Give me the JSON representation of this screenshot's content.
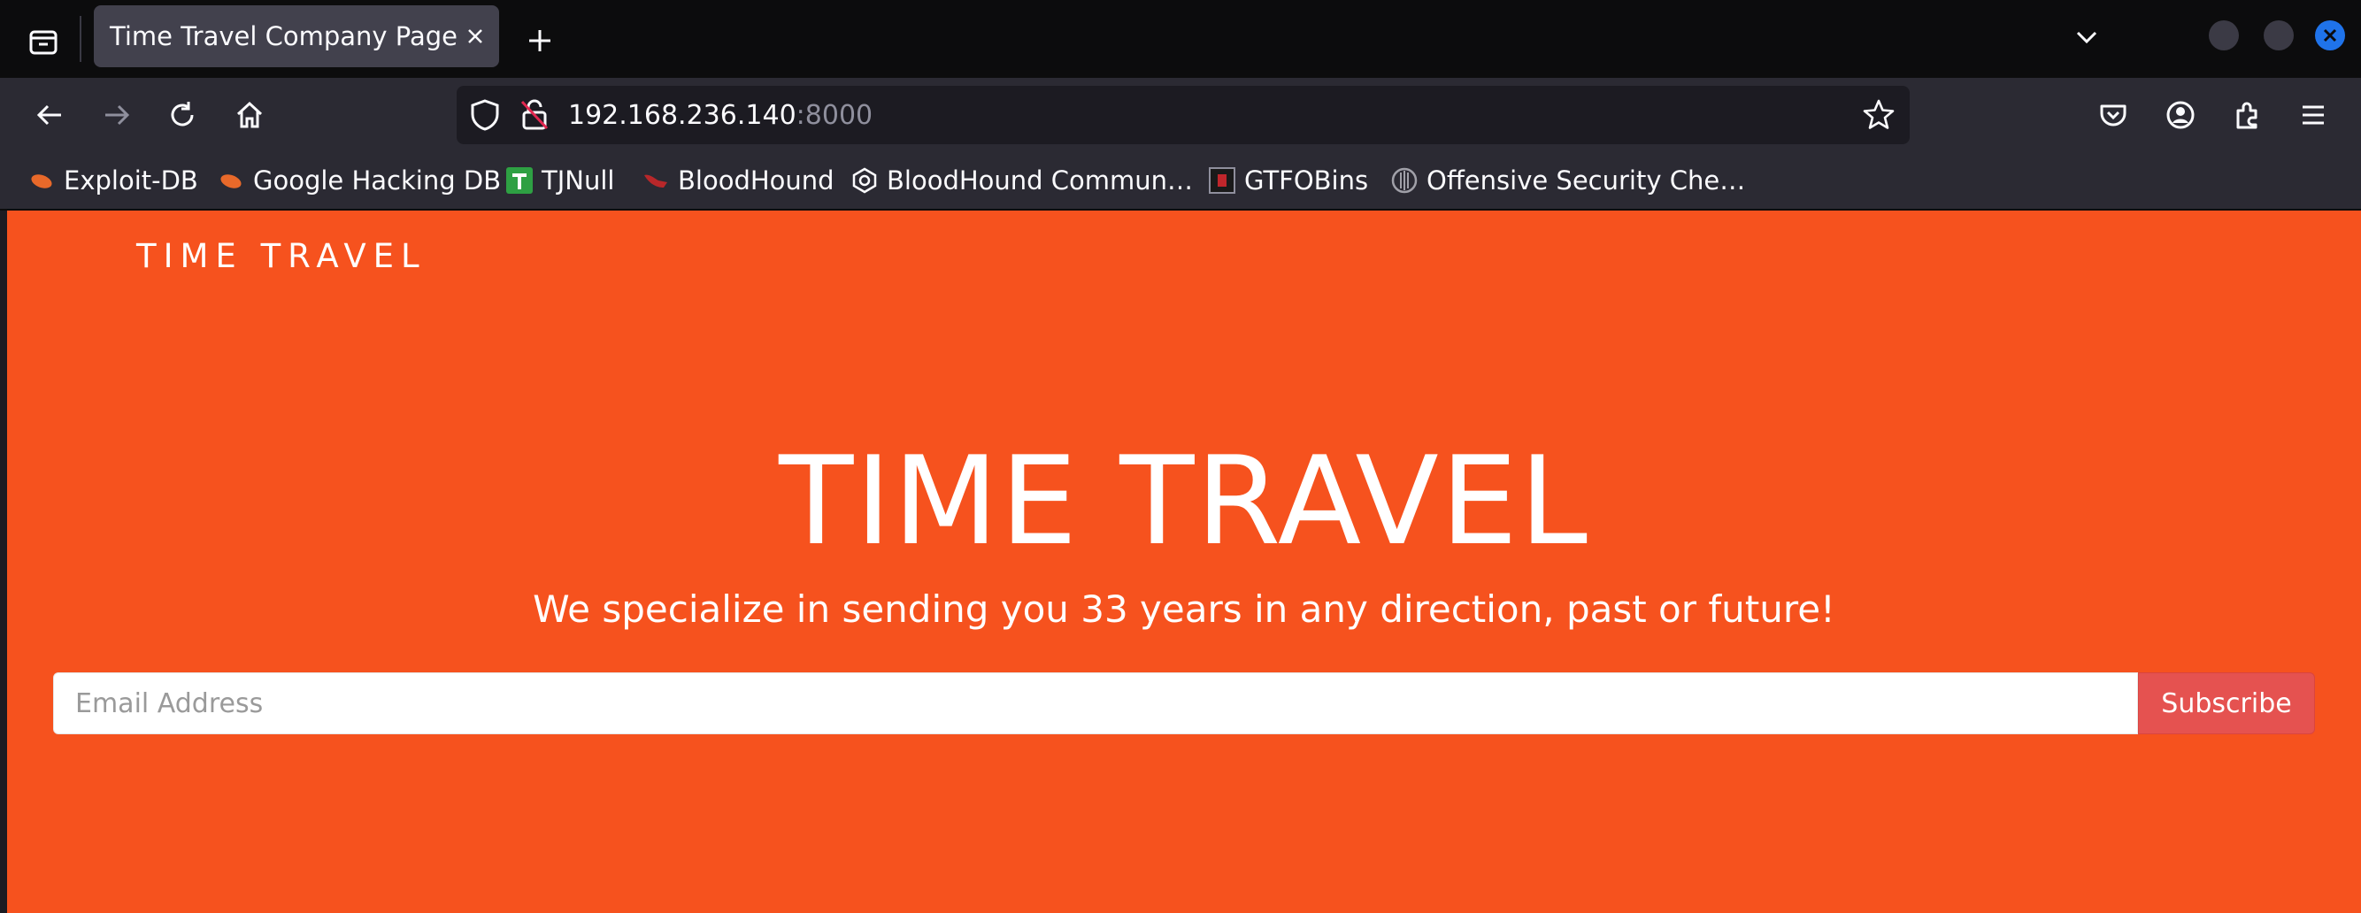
{
  "browser": {
    "tab_title": "Time Travel Company Page",
    "url_host": "192.168.236.140",
    "url_port": ":8000",
    "bookmarks": [
      {
        "label": "Exploit-DB",
        "icon": "exploit-db-icon"
      },
      {
        "label": "Google Hacking DB",
        "icon": "ghdb-icon"
      },
      {
        "label": "TJNull",
        "icon": "tjnull-icon"
      },
      {
        "label": "BloodHound",
        "icon": "bloodhound-icon"
      },
      {
        "label": "BloodHound Commun…",
        "icon": "bloodhound-community-icon"
      },
      {
        "label": "GTFOBins",
        "icon": "gtfobins-icon"
      },
      {
        "label": "Offensive Security Che…",
        "icon": "offsec-icon"
      }
    ],
    "colors": {
      "accent": "#1f73ea",
      "chrome": "#2b2a33",
      "tabbar": "#0c0c0d"
    }
  },
  "page": {
    "brand": "TIME TRAVEL",
    "title": "TIME TRAVEL",
    "subtitle": "We specialize in sending you 33 years in any direction, past or future!",
    "email_placeholder": "Email Address",
    "subscribe_label": "Subscribe",
    "colors": {
      "background": "#f6521e",
      "button": "#e55250"
    }
  }
}
